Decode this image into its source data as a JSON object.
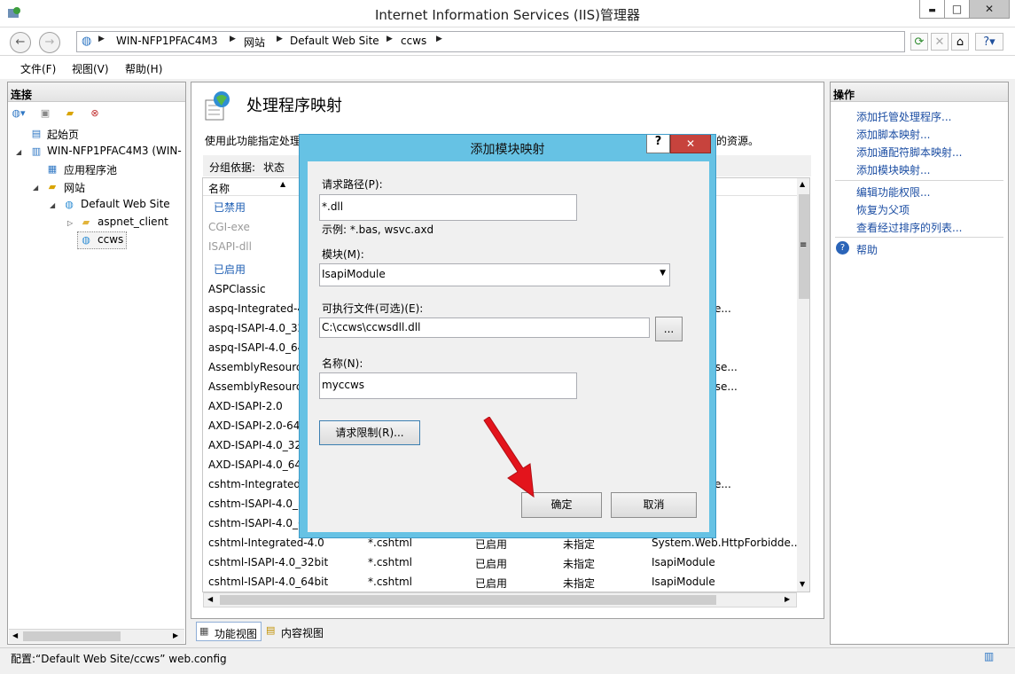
{
  "window": {
    "title": "Internet Information Services (IIS)管理器",
    "controls": [
      "▬",
      "□",
      "✕"
    ]
  },
  "address": {
    "crumbs": [
      "WIN-NFP1PFAC4M3",
      "网站",
      "Default Web Site",
      "ccws"
    ]
  },
  "menu": [
    "文件(F)",
    "视图(V)",
    "帮助(H)"
  ],
  "connections": {
    "title": "连接",
    "tree": [
      "起始页",
      "WIN-NFP1PFAC4M3 (WIN-",
      "应用程序池",
      "网站",
      "Default Web Site",
      "aspnet_client",
      "ccws"
    ]
  },
  "main": {
    "title": "处理程序映射",
    "description": "使用此功能指定处理",
    "description_tail": "的资源。",
    "groupby_label": "分组依据:",
    "groupby_value": "状态",
    "column_name": "名称",
    "group_disabled": "已禁用",
    "group_enabled": "已启用",
    "rows": [
      {
        "name": "CGI-exe",
        "path": "",
        "state": "",
        "type": "",
        "handler": "",
        "dim": true
      },
      {
        "name": "ISAPI-dll",
        "path": "",
        "state": "",
        "type": "",
        "handler": "",
        "dim": true
      },
      {
        "name": "ASPClassic",
        "path": "",
        "state": "",
        "type": "",
        "handler": ""
      },
      {
        "name": "aspq-Integrated-4",
        "path": "",
        "state": "",
        "type": "",
        "handler": "HttpForbidde..."
      },
      {
        "name": "aspq-ISAPI-4.0_32",
        "path": "",
        "state": "",
        "type": "",
        "handler": ""
      },
      {
        "name": "aspq-ISAPI-4.0_64",
        "path": "",
        "state": "",
        "type": "",
        "handler": ""
      },
      {
        "name": "AssemblyResourc",
        "path": "",
        "state": "",
        "type": "",
        "handler": "Handlers.Asse..."
      },
      {
        "name": "AssemblyResourc",
        "path": "",
        "state": "",
        "type": "",
        "handler": "Handlers.Asse..."
      },
      {
        "name": "AXD-ISAPI-2.0",
        "path": "",
        "state": "",
        "type": "",
        "handler": ""
      },
      {
        "name": "AXD-ISAPI-2.0-64",
        "path": "",
        "state": "",
        "type": "",
        "handler": ""
      },
      {
        "name": "AXD-ISAPI-4.0_32",
        "path": "",
        "state": "",
        "type": "",
        "handler": ""
      },
      {
        "name": "AXD-ISAPI-4.0_64",
        "path": "",
        "state": "",
        "type": "",
        "handler": ""
      },
      {
        "name": "cshtm-Integrated-",
        "path": "",
        "state": "",
        "type": "",
        "handler": "HttpForbidde..."
      },
      {
        "name": "cshtm-ISAPI-4.0_3",
        "path": "",
        "state": "",
        "type": "",
        "handler": ""
      },
      {
        "name": "cshtm-ISAPI-4.0_6",
        "path": "",
        "state": "",
        "type": "",
        "handler": ""
      },
      {
        "name": "cshtml-Integrated-4.0",
        "path": "*.cshtml",
        "state": "已启用",
        "type": "未指定",
        "handler": "System.Web.HttpForbidde..."
      },
      {
        "name": "cshtml-ISAPI-4.0_32bit",
        "path": "*.cshtml",
        "state": "已启用",
        "type": "未指定",
        "handler": "IsapiModule"
      },
      {
        "name": "cshtml-ISAPI-4.0_64bit",
        "path": "*.cshtml",
        "state": "已启用",
        "type": "未指定",
        "handler": "IsapiModule"
      }
    ]
  },
  "actions": {
    "title": "操作",
    "items": [
      "添加托管处理程序...",
      "添加脚本映射...",
      "添加通配符脚本映射...",
      "添加模块映射...",
      "编辑功能权限...",
      "恢复为父项",
      "查看经过排序的列表...",
      "帮助"
    ]
  },
  "bottom_tabs": [
    "功能视图",
    "内容视图"
  ],
  "status": "配置:“Default Web Site/ccws” web.config",
  "dialog": {
    "title": "添加模块映射",
    "help": "?",
    "close": "✕",
    "request_path_label": "请求路径(P):",
    "request_path_value": "*.dll",
    "example": "示例: *.bas, wsvc.axd",
    "module_label": "模块(M):",
    "module_value": "IsapiModule",
    "exe_label": "可执行文件(可选)(E):",
    "exe_value": "C:\\ccws\\ccwsdll.dll",
    "browse": "...",
    "name_label": "名称(N):",
    "name_value": "myccws",
    "restrictions": "请求限制(R)...",
    "ok": "确定",
    "cancel": "取消"
  },
  "colors": {
    "accent": "#66c2e4",
    "arrow": "#e3141c",
    "link": "#1c4ea3"
  }
}
